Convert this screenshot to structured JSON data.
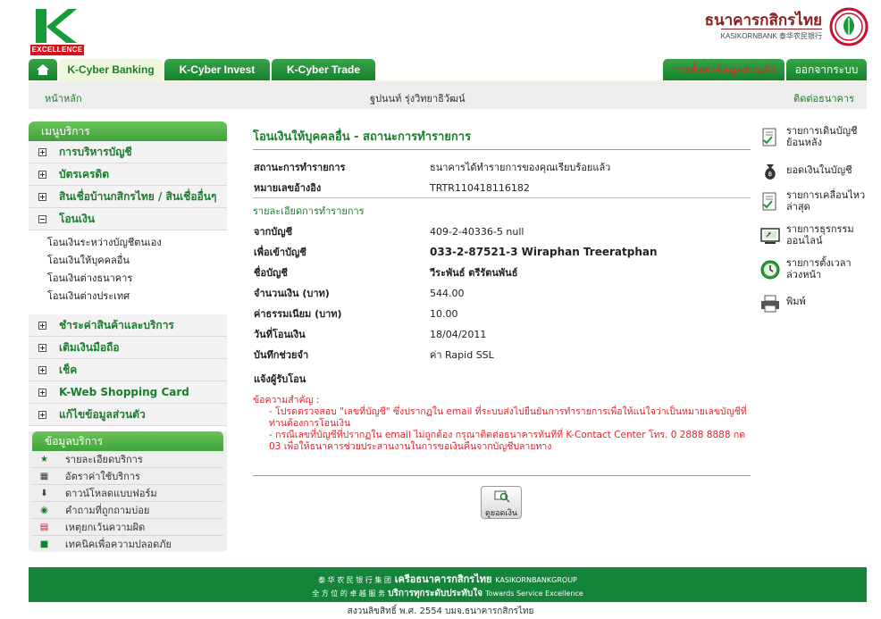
{
  "header": {
    "excellence_label": "EXCELLENCE",
    "bank_name_thai": "ธนาคารกสิกรไทย",
    "bank_name_eng": "KASIKORNBANK 泰华农民银行"
  },
  "tabs": [
    {
      "label": "K-Cyber Banking",
      "active": true
    },
    {
      "label": "K-Cyber Invest",
      "active": false
    },
    {
      "label": "K-Cyber Trade",
      "active": false
    }
  ],
  "tabs_right": {
    "settings_label": "การตั้งค่าข้อมูลส่วนตัว",
    "logout_label": "ออกจากระบบ"
  },
  "subbar": {
    "home_label": "หน้าหลัก",
    "user_name": "ฐปนนท์ รุ่งวิทยาธิวัฒน์",
    "contact_label": "ติดต่อธนาคาร"
  },
  "sidebar": {
    "title": "เมนูบริการ",
    "items_top": [
      {
        "label": "การบริหารบัญชี",
        "expanded": false
      },
      {
        "label": "บัตรเครดิต",
        "expanded": false
      },
      {
        "label": "สินเชื่อบ้านกสิกรไทย / สินเชื่ออื่นๆ",
        "expanded": false
      },
      {
        "label": "โอนเงิน",
        "expanded": true
      }
    ],
    "transfer_sub": [
      "โอนเงินระหว่างบัญชีตนเอง",
      "โอนเงินให้บุคคลอื่น",
      "โอนเงินต่างธนาคาร",
      "โอนเงินต่างประเทศ"
    ],
    "items_bottom": [
      {
        "label": "ชำระค่าสินค้าและบริการ"
      },
      {
        "label": "เติมเงินมือถือ"
      },
      {
        "label": "เช็ค"
      },
      {
        "label": "K-Web Shopping Card"
      },
      {
        "label": "แก้ไขข้อมูลส่วนตัว"
      }
    ]
  },
  "info": {
    "title": "ข้อมูลบริการ",
    "items": [
      {
        "label": "รายละเอียดบริการ",
        "icon": "star-icon"
      },
      {
        "label": "อัตราค่าใช้บริการ",
        "icon": "calculator-icon"
      },
      {
        "label": "ดาวน์โหลดแบบฟอร์ม",
        "icon": "download-icon"
      },
      {
        "label": "คำถามที่ถูกถามบ่อย",
        "icon": "question-icon"
      },
      {
        "label": "เหตุยกเว้นความผิด",
        "icon": "book-icon"
      },
      {
        "label": "เทคนิคเพื่อความปลอดภัย",
        "icon": "lock-icon"
      }
    ]
  },
  "main": {
    "title": "โอนเงินให้บุคคลอื่น - สถานะการทำรายการ",
    "status_label": "สถานะการทำรายการ",
    "status_value": "ธนาคารได้ทำรายการของคุณเรียบร้อยแล้ว",
    "ref_label": "หมายเลขอ้างอิง",
    "ref_value": "TRTR110418116182",
    "detail_head": "รายละเอียดการทำรายการ",
    "details": [
      {
        "label": "จากบัญชี",
        "value": "409-2-40336-5 null",
        "big": false
      },
      {
        "label": "เพื่อเข้าบัญชี",
        "value": "033-2-87521-3 Wiraphan Treeratphan",
        "big": true
      },
      {
        "label": "ชื่อบัญชี",
        "value": "วีระพันธ์ ตรีรัตนพันธ์",
        "big": false
      },
      {
        "label": "จำนวนเงิน (บาท)",
        "value": "544.00",
        "big": false
      },
      {
        "label": "ค่าธรรมเนียม (บาท)",
        "value": "10.00",
        "big": false
      },
      {
        "label": "วันที่โอนเงิน",
        "value": "18/04/2011",
        "big": false
      },
      {
        "label": "บันทึกช่วยจำ",
        "value": "ค่า Rapid SSL",
        "big": false
      }
    ],
    "notify_label": "แจ้งผู้รับโอน",
    "notice_title": "ข้อความสำคัญ :",
    "notice_1": "- โปรดตรวจสอบ \"เลขที่บัญชี\" ซึ่งปรากฏใน email ที่ระบบส่งไปยืนยันการทำรายการเพื่อให้แน่ใจว่าเป็นหมายเลขบัญชีที่ท่านต้องการโอนเงิน",
    "notice_2": "- กรณีเลขที่บัญชีที่ปรากฏใน email ไม่ถูกต้อง กรุณาติดต่อธนาคารทันทีที่ K-Contact Center โทร. 0 2888 8888 กด 03 เพื่อให้ธนาคารช่วยประสานงานในการขอเงินคืนจากบัญชีปลายทาง",
    "check_balance_label": "ดูยอดเงิน"
  },
  "right_menu": [
    {
      "label": "รายการเดินบัญชีย้อนหลัง",
      "icon": "statement-icon"
    },
    {
      "label": "ยอดเงินในบัญชี",
      "icon": "money-bag-icon"
    },
    {
      "label": "รายการเคลื่อนไหวล่าสุด",
      "icon": "recent-activity-icon"
    },
    {
      "label": "รายการธุรกรรมออนไลน์",
      "icon": "online-transaction-icon"
    },
    {
      "label": "รายการตั้งเวลาล่วงหน้า",
      "icon": "clock-icon"
    },
    {
      "label": "พิมพ์",
      "icon": "printer-icon"
    }
  ],
  "footer": {
    "line1_cn": "泰 华 农 民 银 行 集 团",
    "line1_thai": "เครือธนาคารกสิกรไทย",
    "line1_eng": "KASIKORNBANKGROUP",
    "line2_cn": "全 方 位 的 卓 越 服 务",
    "line2_thai": "บริการทุกระดับประทับใจ",
    "line2_eng": "Towards Service Excellence",
    "copyright": "สงวนลิขสิทธิ์ พ.ศ. 2554 บมจ.ธนาคารกสิกรไทย"
  },
  "colors": {
    "brand_green": "#1a7e2c",
    "accent_red": "#e0242a",
    "brand_maroon": "#8b1d20"
  }
}
